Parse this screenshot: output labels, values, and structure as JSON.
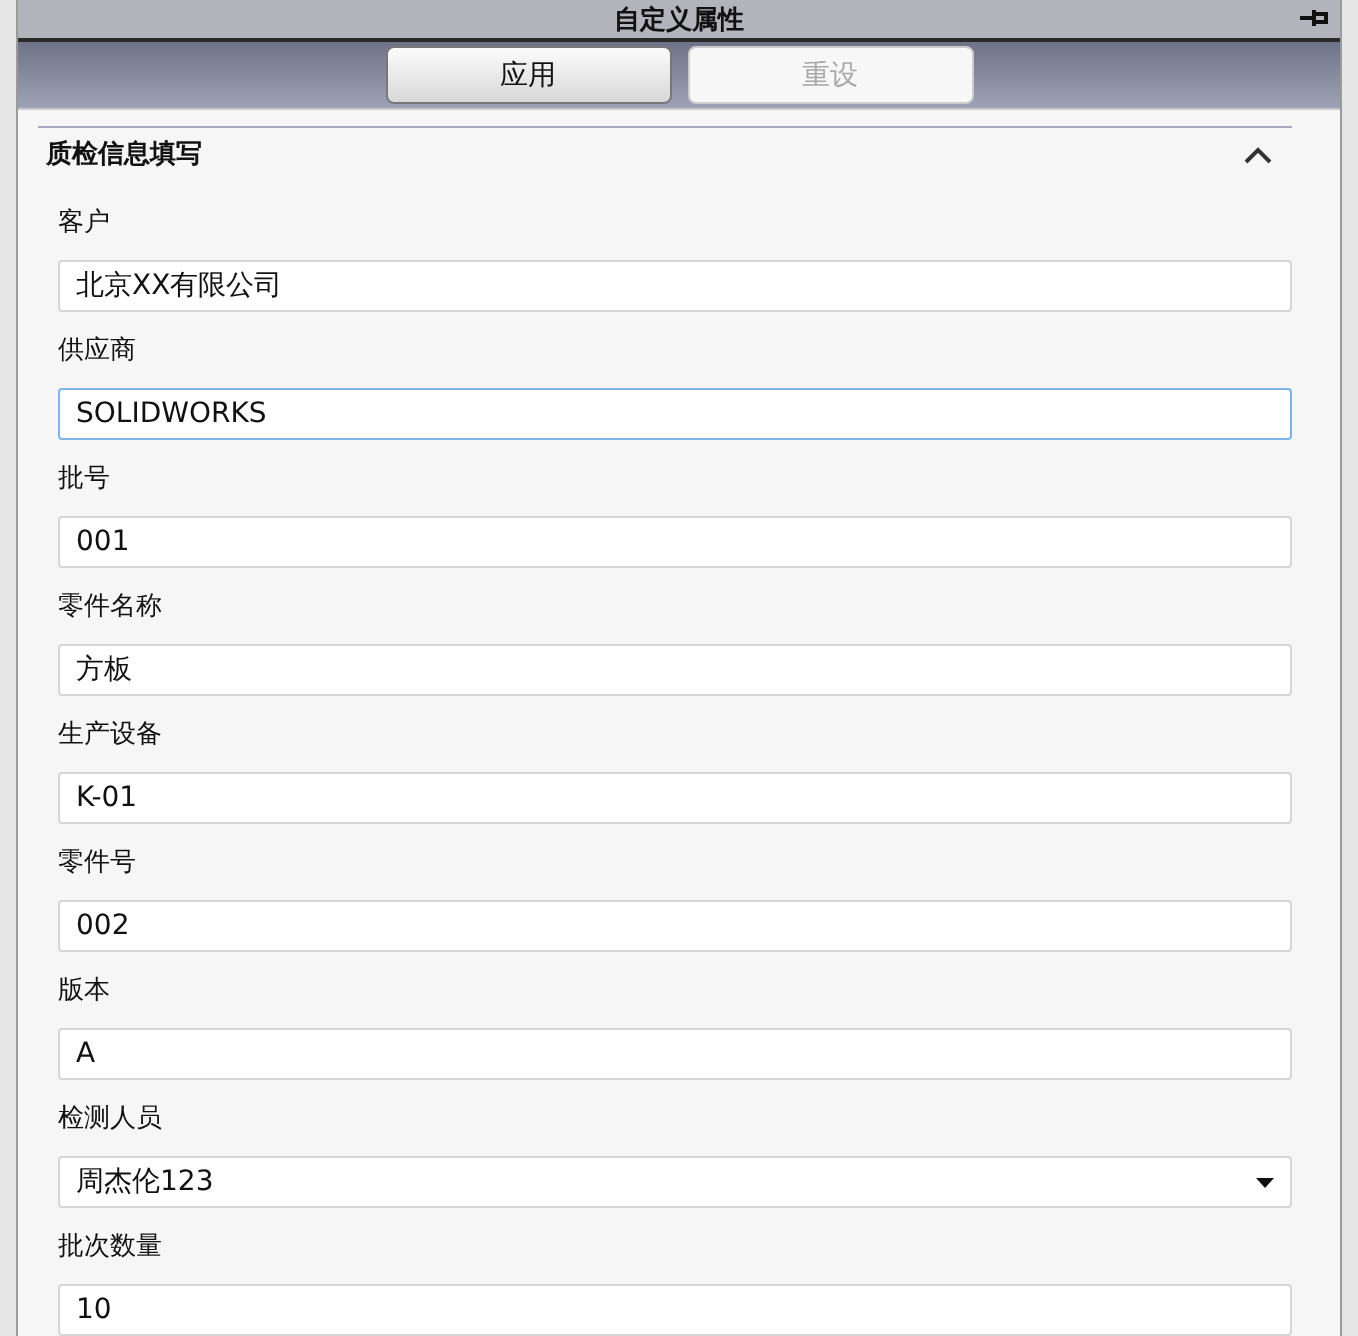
{
  "window": {
    "title": "自定义属性"
  },
  "buttons": [
    {
      "label": "应用",
      "disabled": false
    },
    {
      "label": "重设",
      "disabled": true
    }
  ],
  "section": {
    "title": "质检信息填写",
    "expanded": true,
    "fields": [
      {
        "label": "客户",
        "kind": "text",
        "value": "北京XX有限公司",
        "focused": false
      },
      {
        "label": "供应商",
        "kind": "text",
        "value": "SOLIDWORKS",
        "focused": true
      },
      {
        "label": "批号",
        "kind": "text",
        "value": "001",
        "focused": false
      },
      {
        "label": "零件名称",
        "kind": "text",
        "value": "方板",
        "focused": false
      },
      {
        "label": "生产设备",
        "kind": "text",
        "value": "K-01",
        "focused": false
      },
      {
        "label": "零件号",
        "kind": "text",
        "value": "002",
        "focused": false
      },
      {
        "label": "版本",
        "kind": "text",
        "value": "A",
        "focused": false
      },
      {
        "label": "检测人员",
        "kind": "dropdown",
        "value": "周杰伦123",
        "focused": false
      },
      {
        "label": "批次数量",
        "kind": "text",
        "value": "10",
        "focused": false
      }
    ]
  }
}
